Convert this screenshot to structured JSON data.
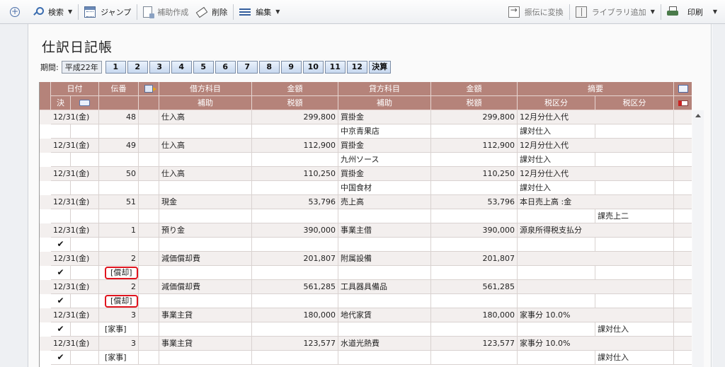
{
  "toolbar": {
    "search": "検索",
    "jump": "ジャンプ",
    "create_aux": "補助作成",
    "delete": "削除",
    "edit": "編集",
    "convert_transfer": "振伝に変換",
    "add_library": "ライブラリ追加",
    "print": "印刷"
  },
  "page": {
    "title": "仕訳日記帳",
    "period_label": "期間:",
    "era": "平成22年",
    "months": [
      "1",
      "2",
      "3",
      "4",
      "5",
      "6",
      "7",
      "8",
      "9",
      "10",
      "11",
      "12"
    ],
    "settlement": "決算"
  },
  "table": {
    "headers_top": {
      "date": "日付",
      "voucher": "伝番",
      "debit_account": "借方科目",
      "debit_amount": "金額",
      "credit_account": "貸方科目",
      "credit_amount": "金額",
      "summary": "摘要"
    },
    "headers_bottom": {
      "settle": "決",
      "debit_sub": "補助",
      "debit_tax": "税額",
      "credit_sub": "補助",
      "credit_tax": "税額",
      "tax_class1": "税区分",
      "tax_class2": "税区分"
    },
    "rows": [
      {
        "date": "12/31(金)",
        "no": "48",
        "debit": "仕入高",
        "debit_amount": "299,800",
        "credit": "買掛金",
        "credit_amount": "299,800",
        "summary": "12月分仕入代",
        "check": "",
        "voucher_tag": "",
        "credit_sub": "中京青果店",
        "tax1": "課対仕入",
        "tax2": "",
        "marked": false,
        "tag_red": false
      },
      {
        "date": "12/31(金)",
        "no": "49",
        "debit": "仕入高",
        "debit_amount": "112,900",
        "credit": "買掛金",
        "credit_amount": "112,900",
        "summary": "12月分仕入代",
        "check": "",
        "voucher_tag": "",
        "credit_sub": "九州ソース",
        "tax1": "課対仕入",
        "tax2": "",
        "marked": false,
        "tag_red": false
      },
      {
        "date": "12/31(金)",
        "no": "50",
        "debit": "仕入高",
        "debit_amount": "110,250",
        "credit": "買掛金",
        "credit_amount": "110,250",
        "summary": "12月分仕入代",
        "check": "",
        "voucher_tag": "",
        "credit_sub": "中国食材",
        "tax1": "課対仕入",
        "tax2": "",
        "marked": false,
        "tag_red": false
      },
      {
        "date": "12/31(金)",
        "no": "51",
        "debit": "現金",
        "debit_amount": "53,796",
        "credit": "売上高",
        "credit_amount": "53,796",
        "summary": "本日売上高 :金",
        "check": "",
        "voucher_tag": "",
        "credit_sub": "",
        "tax1": "",
        "tax2": "課売上二",
        "marked": false,
        "tag_red": false
      },
      {
        "date": "12/31(金)",
        "no": "1",
        "debit": "預り金",
        "debit_amount": "390,000",
        "credit": "事業主借",
        "credit_amount": "390,000",
        "summary": "源泉所得税支払分",
        "check": "✔",
        "voucher_tag": "",
        "credit_sub": "",
        "tax1": "",
        "tax2": "",
        "marked": false,
        "tag_red": false
      },
      {
        "date": "12/31(金)",
        "no": "2",
        "debit": "減価償却費",
        "debit_amount": "201,807",
        "credit": "附属設備",
        "credit_amount": "201,807",
        "summary": "",
        "check": "✔",
        "voucher_tag": "[償却]",
        "credit_sub": "",
        "tax1": "",
        "tax2": "",
        "marked": true,
        "tag_red": true
      },
      {
        "date": "12/31(金)",
        "no": "2",
        "debit": "減価償却費",
        "debit_amount": "561,285",
        "credit": "工具器具備品",
        "credit_amount": "561,285",
        "summary": "",
        "check": "✔",
        "voucher_tag": "[償却]",
        "credit_sub": "",
        "tax1": "",
        "tax2": "",
        "marked": true,
        "tag_red": true
      },
      {
        "date": "12/31(金)",
        "no": "3",
        "debit": "事業主貸",
        "debit_amount": "180,000",
        "credit": "地代家賃",
        "credit_amount": "180,000",
        "summary": "家事分 10.0%",
        "check": "✔",
        "voucher_tag": "[家事]",
        "credit_sub": "",
        "tax1": "",
        "tax2": "課対仕入",
        "marked": true,
        "tag_red": false
      },
      {
        "date": "12/31(金)",
        "no": "3",
        "debit": "事業主貸",
        "debit_amount": "123,577",
        "credit": "水道光熱費",
        "credit_amount": "123,577",
        "summary": "家事分 10.0%",
        "check": "✔",
        "voucher_tag": "[家事]",
        "credit_sub": "",
        "tax1": "",
        "tax2": "課対仕入",
        "marked": true,
        "tag_red": false
      }
    ]
  }
}
